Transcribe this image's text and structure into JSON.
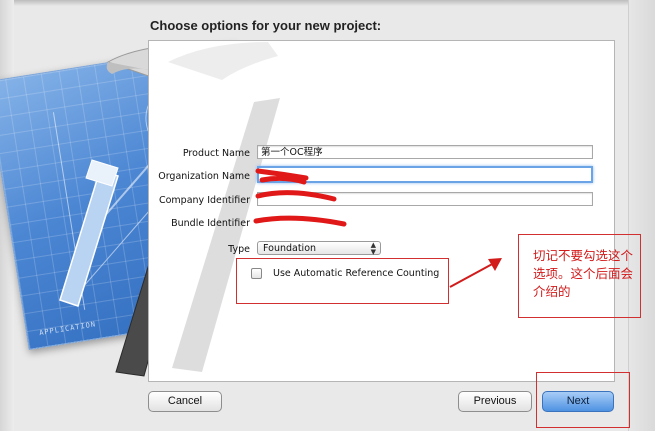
{
  "dialog": {
    "title": "Choose options for your new project:"
  },
  "form": {
    "product_name": {
      "label": "Product Name",
      "value": "第一个OC程序"
    },
    "organization_name": {
      "label": "Organization Name",
      "value": ""
    },
    "company_identifier": {
      "label": "Company Identifier",
      "value": ""
    },
    "bundle_identifier": {
      "label": "Bundle Identifier",
      "value": ""
    },
    "type": {
      "label": "Type",
      "value": "Foundation"
    },
    "arc": {
      "label": "Use Automatic Reference Counting",
      "checked": false
    }
  },
  "annotation": {
    "text": "切记不要勾选这个选项。这个后面会介绍的"
  },
  "buttons": {
    "cancel": "Cancel",
    "previous": "Previous",
    "next": "Next"
  },
  "artwork": {
    "caption": "APPLICATION"
  },
  "colors": {
    "markup_red": "#d23030",
    "focus_blue": "#6aa3e6",
    "primary_blue": "#4f92e2"
  }
}
